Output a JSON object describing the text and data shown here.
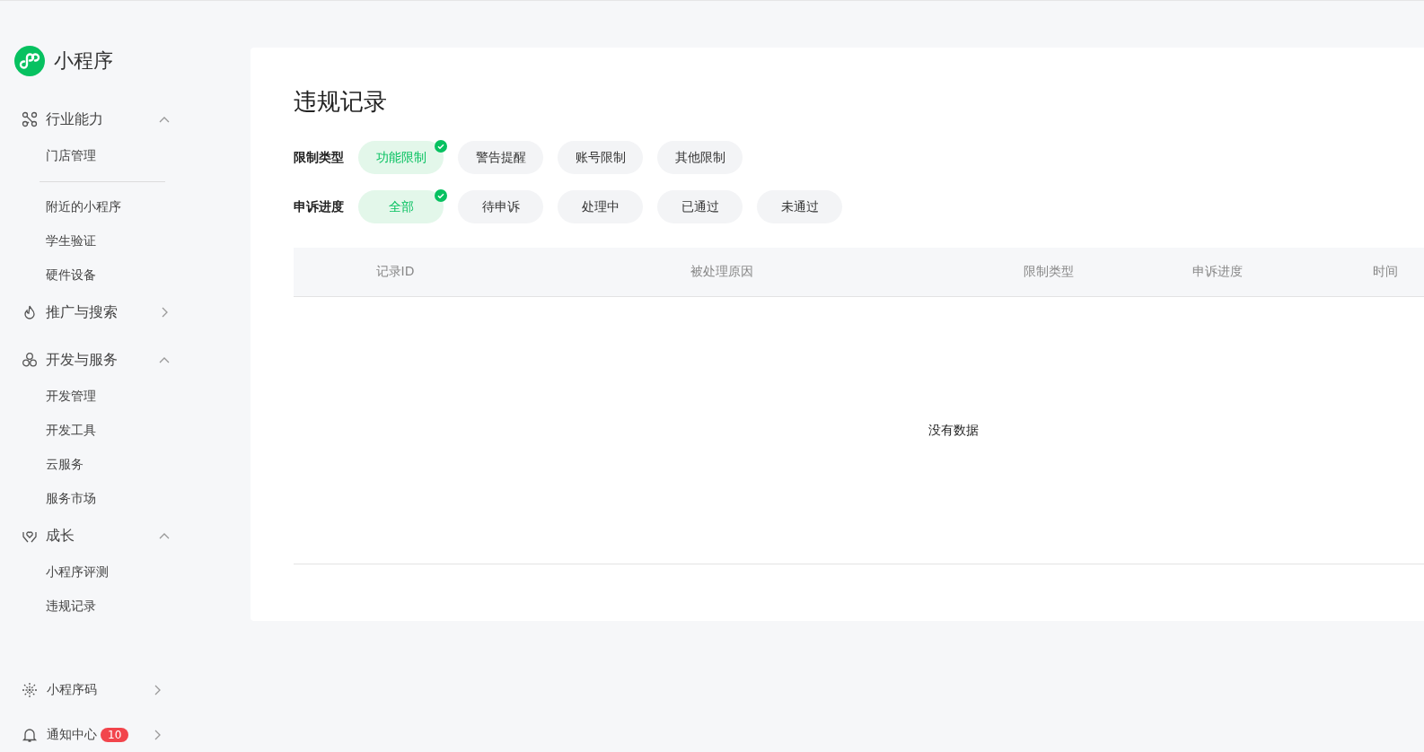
{
  "app": {
    "name": "小程序"
  },
  "sidebar": {
    "groups": [
      {
        "label": "行业能力",
        "expanded": true,
        "items": [
          {
            "label": "门店管理",
            "divider_after": true
          },
          {
            "label": "附近的小程序"
          },
          {
            "label": "学生验证"
          },
          {
            "label": "硬件设备"
          }
        ]
      },
      {
        "label": "推广与搜索",
        "expanded": false
      },
      {
        "label": "开发与服务",
        "expanded": true,
        "items": [
          {
            "label": "开发管理"
          },
          {
            "label": "开发工具"
          },
          {
            "label": "云服务"
          },
          {
            "label": "服务市场"
          }
        ]
      },
      {
        "label": "成长",
        "expanded": true,
        "items": [
          {
            "label": "小程序评测"
          },
          {
            "label": "违规记录"
          }
        ]
      }
    ],
    "bottom": [
      {
        "label": "小程序码"
      },
      {
        "label": "通知中心",
        "badge": "10"
      }
    ]
  },
  "page": {
    "title": "违规记录",
    "filters": [
      {
        "label": "限制类型",
        "options": [
          {
            "label": "功能限制",
            "selected": true
          },
          {
            "label": "警告提醒",
            "selected": false
          },
          {
            "label": "账号限制",
            "selected": false
          },
          {
            "label": "其他限制",
            "selected": false
          }
        ]
      },
      {
        "label": "申诉进度",
        "options": [
          {
            "label": "全部",
            "selected": true
          },
          {
            "label": "待申诉",
            "selected": false
          },
          {
            "label": "处理中",
            "selected": false
          },
          {
            "label": "已通过",
            "selected": false
          },
          {
            "label": "未通过",
            "selected": false
          }
        ]
      }
    ],
    "table": {
      "columns": [
        "记录ID",
        "被处理原因",
        "限制类型",
        "申诉进度",
        "时间"
      ],
      "empty_text": "没有数据"
    }
  }
}
